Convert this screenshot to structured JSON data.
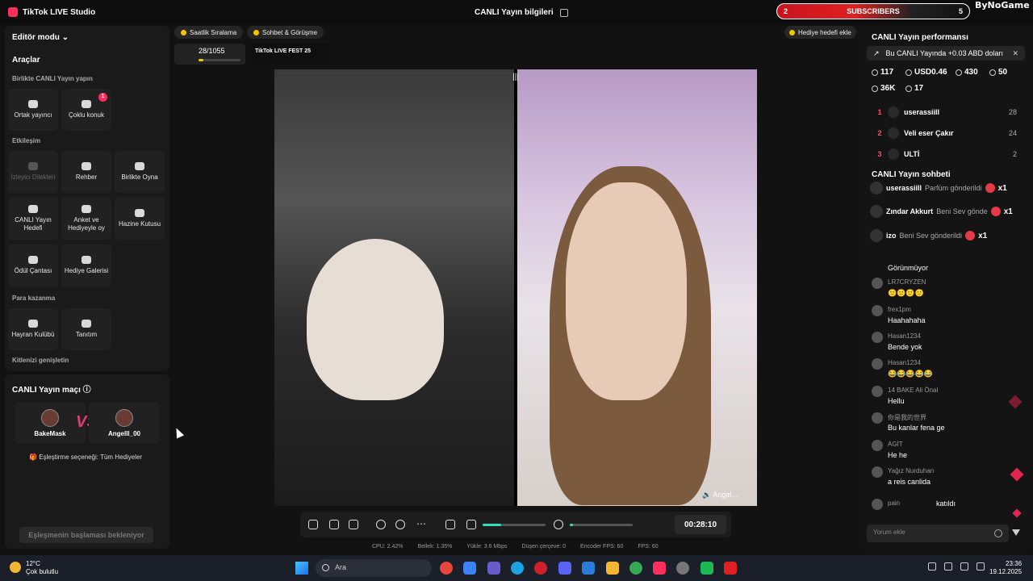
{
  "app": {
    "title": "TikTok LIVE Studio",
    "center_title": "CANLI Yayın bilgileri"
  },
  "widget": {
    "left_count": "2",
    "label": "SUBSCRIBERS",
    "right_count": "5"
  },
  "brand": "ByNoGame",
  "left": {
    "editor_mode": "Editör modu",
    "tools_title": "Araçlar",
    "live_together": "Birlikte CANLI Yayın yapın",
    "cohost": "Ortak yayıncı",
    "multi_guest": "Çoklu konuk",
    "multi_badge": "1",
    "interaction": "Etkileşim",
    "viewer_requests": "İzleyici Dilekleri",
    "guide": "Rehber",
    "play_together": "Birlikte Oyna",
    "live_goal": "CANLI Yayın Hedefi",
    "poll": "Anket ve Hediyeyle oy",
    "treasure": "Hazine Kutusu",
    "reward_bag": "Ödül Çantası",
    "gift_gallery": "Hediye Galerisi",
    "monetize": "Para kazanma",
    "fan_club": "Hayran Kulübü",
    "promo": "Tanıtım",
    "expand": "Kitlenizi genişletin",
    "match_title": "CANLI Yayın maçı",
    "player1": "BakeMask",
    "player2": "Angelll_00",
    "vs": "VS",
    "pair_option": "Eşleştirme seçeneği: Tüm Hediyeler",
    "waiting": "Eşleşmenin başlaması bekleniyor"
  },
  "center": {
    "hourly": "Saatlik Sıralama",
    "chat_meet": "Sohbet & Görüşme",
    "rank_value": "28/1055",
    "rank_progress": 0.12,
    "fest": "TikTok LIVE FEST 25",
    "gift_goal": "Hediye hedefi ekle",
    "video_name": "Angel...",
    "timer": "00:28:10",
    "volume": 0.3,
    "mic": 0.05,
    "stats": {
      "cpu": "CPU: 2.42%",
      "mem": "Bellek: 1.35%",
      "upload": "Yükle: 3.6 Mbps",
      "dropped": "Düşen çerçeve: 0",
      "encoder": "Encoder FPS: 60",
      "fps": "FPS: 60"
    }
  },
  "right": {
    "performance_title": "CANLI Yayın performansı",
    "earnings": "Bu CANLI Yayında +0.03 ABD doları",
    "metrics": {
      "diamonds": "117",
      "usd": "USD0.46",
      "viewers": "430",
      "new": "50",
      "likes": "36K",
      "gifters": "17"
    },
    "top_gifters": [
      {
        "rank": "1",
        "name": "userassiill",
        "score": "28"
      },
      {
        "rank": "2",
        "name": "Veli eser Çakır",
        "score": "24"
      },
      {
        "rank": "3",
        "name": "ULTİ",
        "score": "2"
      }
    ],
    "chat_title": "CANLI Yayın sohbeti",
    "gifts": [
      {
        "user": "userassiill",
        "text": "Parfüm gönderildi",
        "count": "x1"
      },
      {
        "user": "Zındar Akkurt",
        "text": "Beni Sev gönde",
        "count": "x1"
      },
      {
        "user": "izo",
        "text": "Beni Sev gönderildi",
        "count": "x1"
      }
    ],
    "messages": [
      {
        "user": "",
        "text": "Görünmüyor"
      },
      {
        "user": "LR7CRYZEN",
        "text": "🙂🙂🙂🙂"
      },
      {
        "user": "frex1pm",
        "text": "Haahahaha"
      },
      {
        "user": "Hasan1234",
        "text": "Bende yok"
      },
      {
        "user": "Hasan1234",
        "text": "😂😂😂😂😂"
      },
      {
        "user": "14 BAKE Ali Önal",
        "text": "Hellu"
      },
      {
        "user": "你是我的世界",
        "text": "Bu kanlar fena ge"
      },
      {
        "user": "AGİT",
        "text": "He he"
      },
      {
        "user": "Yağız Nurduhan",
        "text": "a reis canlida"
      },
      {
        "user": "pain",
        "text": "katıldı"
      }
    ],
    "comment_placeholder": "Yorum ekle"
  },
  "taskbar": {
    "temp": "12°C",
    "weather": "Çok bulutlu",
    "search": "Ara",
    "time": "23:36",
    "date": "19.12.2025"
  }
}
